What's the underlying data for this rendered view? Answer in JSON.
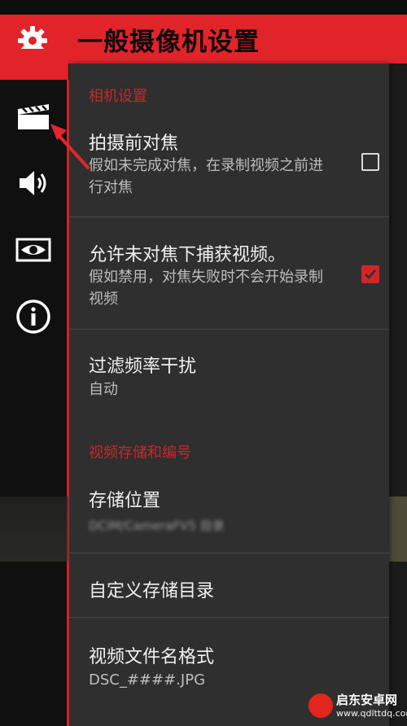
{
  "header": {
    "title": "一般摄像机设置",
    "accent_color": "#e0242a",
    "icon": "gear-icon"
  },
  "sidebar": {
    "items": [
      {
        "icon": "video-clapper-icon",
        "name": "video"
      },
      {
        "icon": "speaker-icon",
        "name": "audio"
      },
      {
        "icon": "eye-icon",
        "name": "preview"
      },
      {
        "icon": "info-icon",
        "name": "info"
      }
    ]
  },
  "sections": {
    "camera": {
      "header": "相机设置"
    },
    "storage": {
      "header": "视频存储和编号"
    }
  },
  "items": {
    "focus_before": {
      "title": "拍摄前对焦",
      "subtitle": "假如未完成对焦，在录制视频之前进行对焦",
      "checked": false
    },
    "allow_unfocused": {
      "title": "允许未对焦下捕获视频。",
      "subtitle": "假如禁用，对焦失败时不会开始录制视频",
      "checked": true
    },
    "flicker": {
      "title": "过滤频率干扰",
      "value": "自动"
    },
    "storage_location": {
      "title": "存储位置",
      "value": "DCIM/CameraFV5 目录"
    },
    "custom_dir": {
      "title": "自定义存储目录"
    },
    "filename_format": {
      "title": "视频文件名格式",
      "value": "DSC_####.JPG"
    }
  },
  "watermark": {
    "name": "启东安卓网",
    "url": "www.qdlttdq.com"
  }
}
